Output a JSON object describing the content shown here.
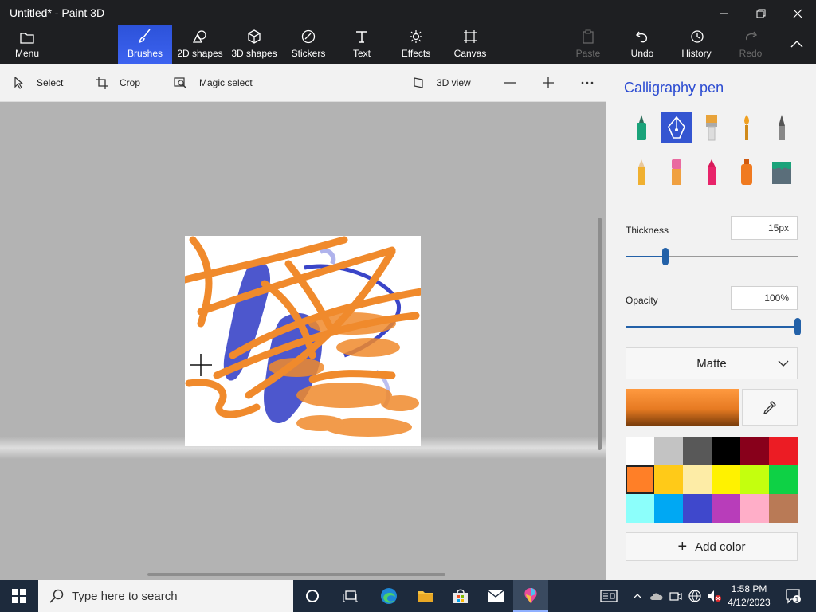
{
  "window": {
    "title": "Untitled* - Paint 3D"
  },
  "ribbon": {
    "menu": "Menu",
    "brushes": "Brushes",
    "shapes2d": "2D shapes",
    "shapes3d": "3D shapes",
    "stickers": "Stickers",
    "text": "Text",
    "effects": "Effects",
    "canvas": "Canvas",
    "paste": "Paste",
    "undo": "Undo",
    "history": "History",
    "redo": "Redo"
  },
  "toolbar": {
    "select": "Select",
    "crop": "Crop",
    "magic_select": "Magic select",
    "view3d": "3D view"
  },
  "panel": {
    "title": "Calligraphy pen",
    "brushes": [
      "marker-icon",
      "calligraphy-pen-icon",
      "oil-brush-icon",
      "watercolor-icon",
      "pixel-pen-icon",
      "pencil-icon",
      "eraser-icon",
      "crayon-icon",
      "spray-can-icon",
      "fill-icon"
    ],
    "thickness_label": "Thickness",
    "thickness_value": "15px",
    "thickness_fraction": 0.23,
    "opacity_label": "Opacity",
    "opacity_value": "100%",
    "opacity_fraction": 1.0,
    "finish": "Matte",
    "current_color": "#f08a2c",
    "palette": [
      "#ffffff",
      "#c3c3c3",
      "#585858",
      "#000000",
      "#88001b",
      "#ec1c24",
      "#ff7f27",
      "#ffca18",
      "#fdeca6",
      "#fff200",
      "#c4ff0e",
      "#0ed145",
      "#8cfffb",
      "#00a8f3",
      "#3f48cc",
      "#b83dba",
      "#ffaec8",
      "#b97a56"
    ],
    "selected_swatch": 6,
    "add_color": "Add color"
  },
  "taskbar": {
    "search_placeholder": "Type here to search",
    "time": "1:58 PM",
    "date": "4/12/2023",
    "notifications": "1"
  }
}
